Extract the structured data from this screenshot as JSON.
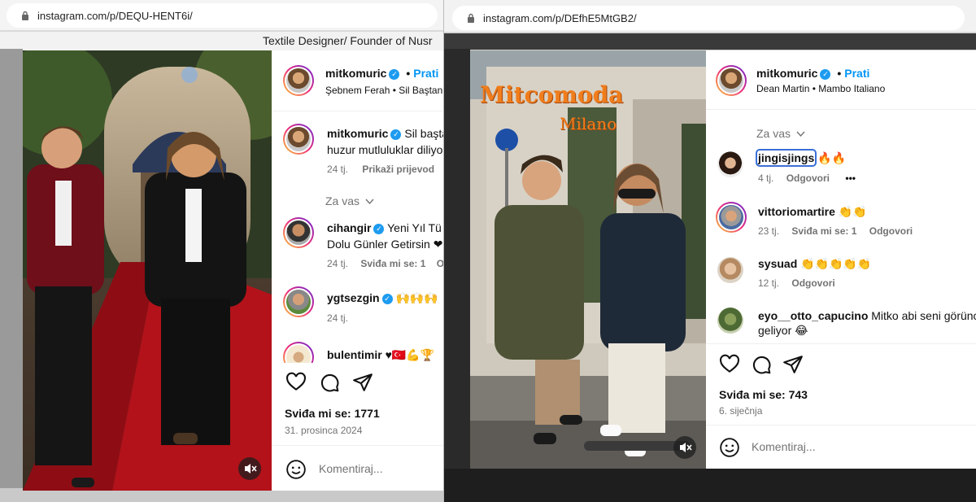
{
  "left": {
    "url": "instagram.com/p/DEQU-HENT6i/",
    "behind_text": "Textile Designer/ Founder of Nusr",
    "header": {
      "username": "mitkomuric",
      "follow_label": "Prati",
      "separator": "•",
      "music": "Şebnem Ferah • Sil Baştan"
    },
    "caption": {
      "username": "mitkomuric",
      "line1": "Sil baştan",
      "line2": "huzur mutluluklar diliyo",
      "time": "24 tj.",
      "translate": "Prikaži prijevod"
    },
    "for_you": "Za vas",
    "comments": [
      {
        "username": "cihangir",
        "line1": "Yeni Yıl Tü",
        "line2": "Dolu Günler Getirsin ❤",
        "time": "24 tj.",
        "likes": "Sviđa mi se: 1",
        "reply": "O"
      },
      {
        "username": "ygtsezgin",
        "line1": "🙌🙌🙌",
        "time": "24 tj."
      },
      {
        "username": "bulentimir",
        "line1": "♥🇹🇷💪🏆"
      }
    ],
    "likes": "Sviđa mi se: 1771",
    "date": "31. prosinca 2024",
    "comment_placeholder": "Komentiraj..."
  },
  "right": {
    "url": "instagram.com/p/DEfhE5MtGB2/",
    "header": {
      "username": "mitkomuric",
      "follow_label": "Prati",
      "separator": "•",
      "music": "Dean Martin • Mambo Italiano"
    },
    "overlay": {
      "brand": "Mitcomoda",
      "city": "Milano"
    },
    "for_you": "Za vas",
    "comments": [
      {
        "username": "jingisjings",
        "text": "🔥🔥",
        "time": "4 tj.",
        "reply": "Odgovori",
        "more": "•••"
      },
      {
        "username": "vittoriomartire",
        "text": "👏👏",
        "time": "23 tj.",
        "likes": "Sviđa mi se: 1",
        "reply": "Odgovori"
      },
      {
        "username": "sysuad",
        "text": "👏👏👏👏👏",
        "time": "12 tj.",
        "reply": "Odgovori"
      },
      {
        "username": "eyo__otto_capucino",
        "text": "Mitko abi seni görünce",
        "text2": "geliyor 😂"
      }
    ],
    "likes": "Sviđa mi se: 743",
    "date": "6. siječnja",
    "comment_placeholder": "Komentiraj..."
  },
  "colors": {
    "accent": "#0095f6",
    "carpet": "#b3121a",
    "ig_gradient": [
      "#f9ce34",
      "#ee2a7b",
      "#6228d7"
    ]
  }
}
